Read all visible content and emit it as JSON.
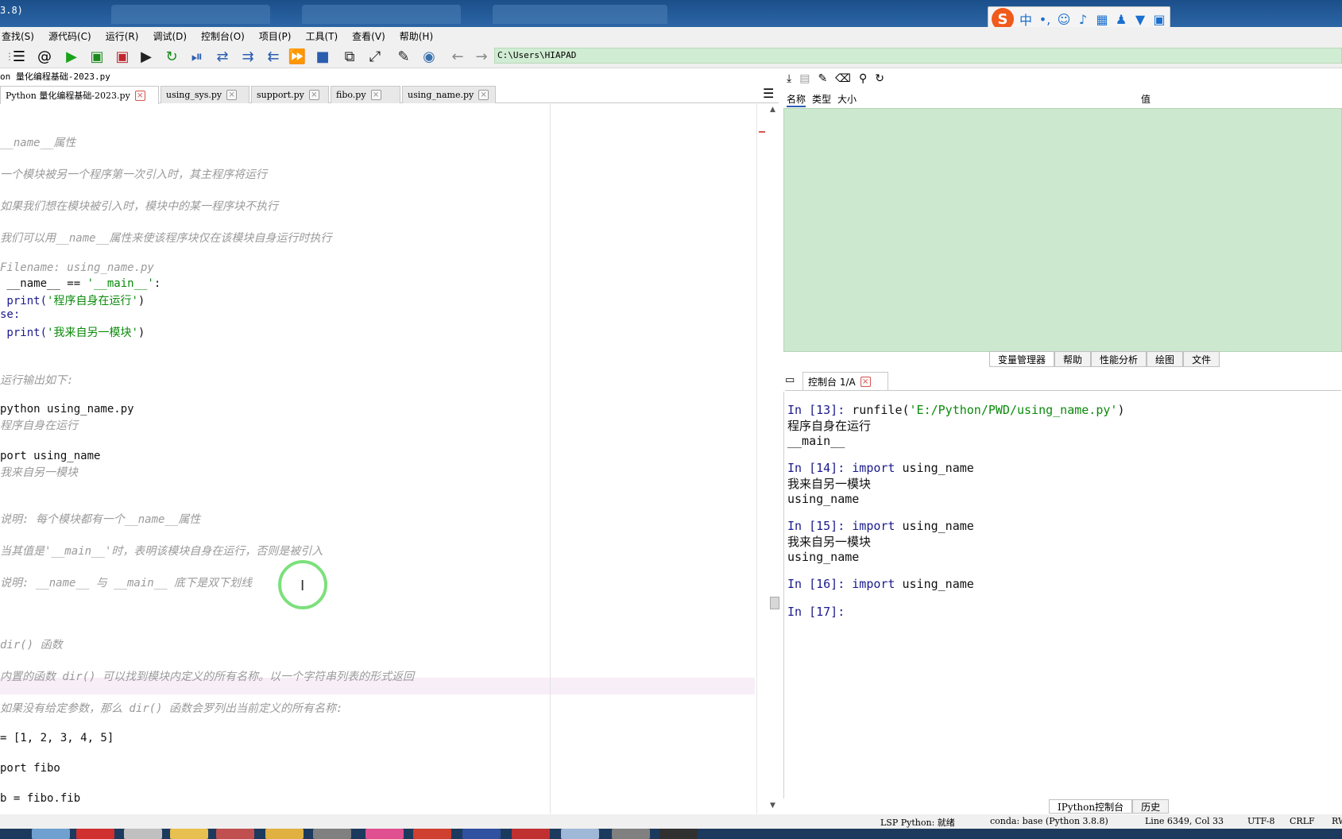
{
  "window": {
    "title_fragment": "3.8)"
  },
  "ime": {
    "items": [
      "中",
      "•,",
      "☺",
      "🎤",
      "⌨",
      "👤",
      "👕",
      "▦"
    ]
  },
  "menu": [
    "查找(S)",
    "源代码(C)",
    "运行(R)",
    "调试(D)",
    "控制台(O)",
    "项目(P)",
    "工具(T)",
    "查看(V)",
    "帮助(H)"
  ],
  "toolbar": {
    "path": "C:\\Users\\HIAPAD",
    "icons": [
      "list-icon",
      "at-icon",
      "run-icon",
      "run-cell-icon",
      "run-cell-advance-icon",
      "run-selection-icon",
      "rerun-icon",
      "debug-icon",
      "step-icon",
      "step-into-icon",
      "step-return-icon",
      "continue-icon",
      "stop-icon",
      "maximize-pane-icon",
      "fullscreen-icon",
      "wrench-icon",
      "python-icon",
      "back-icon",
      "forward-icon"
    ]
  },
  "editor": {
    "filepath": "on 量化编程基础-2023.py",
    "tabs": [
      {
        "label": "Python 量化编程基础-2023.py",
        "active": true
      },
      {
        "label": "using_sys.py",
        "active": false
      },
      {
        "label": "support.py",
        "active": false
      },
      {
        "label": "fibo.py",
        "active": false
      },
      {
        "label": "using_name.py",
        "active": false
      }
    ],
    "lines": [
      {
        "text": "__name__属性",
        "type": "c"
      },
      {
        "text": "一个模块被另一个程序第一次引入时，其主程序将运行",
        "type": "c"
      },
      {
        "text": "如果我们想在模块被引入时，模块中的某一程序块不执行",
        "type": "c"
      },
      {
        "text": "我们可以用__name__属性来使该程序块仅在该模块自身运行时执行",
        "type": "c"
      },
      {
        "text": "Filename: using_name.py",
        "type": "c"
      },
      {
        "text": " __name__ == ",
        "type": "p",
        "str": "'__main__'",
        "tail": ":"
      },
      {
        "text": " print(",
        "type": "p",
        "str": "'程序自身在运行'",
        "tail": ")"
      },
      {
        "text": "se:",
        "type": "p"
      },
      {
        "text": " print(",
        "type": "p",
        "str": "'我来自另一模块'",
        "tail": ")"
      },
      {
        "text": "运行输出如下:",
        "type": "c"
      },
      {
        "text": "python using_name.py",
        "type": "p"
      },
      {
        "text": "程序自身在运行",
        "type": "c"
      },
      {
        "text": "port using_name",
        "type": "p"
      },
      {
        "text": "我来自另一模块",
        "type": "c"
      },
      {
        "text": "说明: 每个模块都有一个__name__属性",
        "type": "c"
      },
      {
        "text": "当其值是'__main__'时，表明该模块自身在运行，否则是被引入",
        "type": "c"
      },
      {
        "text": "说明: __name__ 与 __main__ 底下是双下划线",
        "type": "c"
      },
      {
        "text": "dir() 函数",
        "type": "c"
      },
      {
        "text": "内置的函数 dir() 可以找到模块内定义的所有名称。以一个字符串列表的形式返回",
        "type": "c"
      },
      {
        "text": "如果没有给定参数，那么 dir() 函数会罗列出当前定义的所有名称:",
        "type": "c"
      },
      {
        "text": "= [1, 2, 3, 4, 5]",
        "type": "p"
      },
      {
        "text": "port fibo",
        "type": "p"
      },
      {
        "text": "b = fibo.fib",
        "type": "p"
      }
    ]
  },
  "variables": {
    "toolbar_icons": [
      "import-data-icon",
      "save-data-icon",
      "save-as-icon",
      "eraser-icon",
      "search-icon",
      "refresh-icon"
    ],
    "headers": {
      "name": "名称",
      "type": "类型",
      "size": "大小",
      "value": "值"
    },
    "tabs": [
      {
        "label": "变量管理器",
        "active": true
      },
      {
        "label": "帮助",
        "active": false
      },
      {
        "label": "性能分析",
        "active": false
      },
      {
        "label": "绘图",
        "active": false
      },
      {
        "label": "文件",
        "active": false
      }
    ]
  },
  "console": {
    "tab_label": "控制台 1/A",
    "entries": [
      {
        "prompt": "In [13]: ",
        "code_kw": "runfile(",
        "code_str": "'E:/Python/PWD/using_name.py'",
        "code_tail": ")"
      },
      {
        "output": "程序自身在运行"
      },
      {
        "output": "__main__"
      },
      {
        "prompt": "In [14]: ",
        "code_kw": "import",
        "code_tail": " using_name"
      },
      {
        "output": "我来自另一模块"
      },
      {
        "output": "using_name"
      },
      {
        "prompt": "In [15]: ",
        "code_kw": "import",
        "code_tail": " using_name"
      },
      {
        "output": "我来自另一模块"
      },
      {
        "output": "using_name"
      },
      {
        "prompt": "In [16]: ",
        "code_kw": "import",
        "code_tail": " using_name"
      },
      {
        "prompt": "In [17]: "
      }
    ],
    "bottom_tabs": [
      {
        "label": "IPython控制台",
        "active": true
      },
      {
        "label": "历史",
        "active": false
      }
    ]
  },
  "status": {
    "lsp": "LSP Python: 就绪",
    "conda": "conda: base (Python 3.8.8)",
    "position": "Line 6349, Col 33",
    "encoding": "UTF-8",
    "eol": "CRLF",
    "rw": "RW"
  }
}
